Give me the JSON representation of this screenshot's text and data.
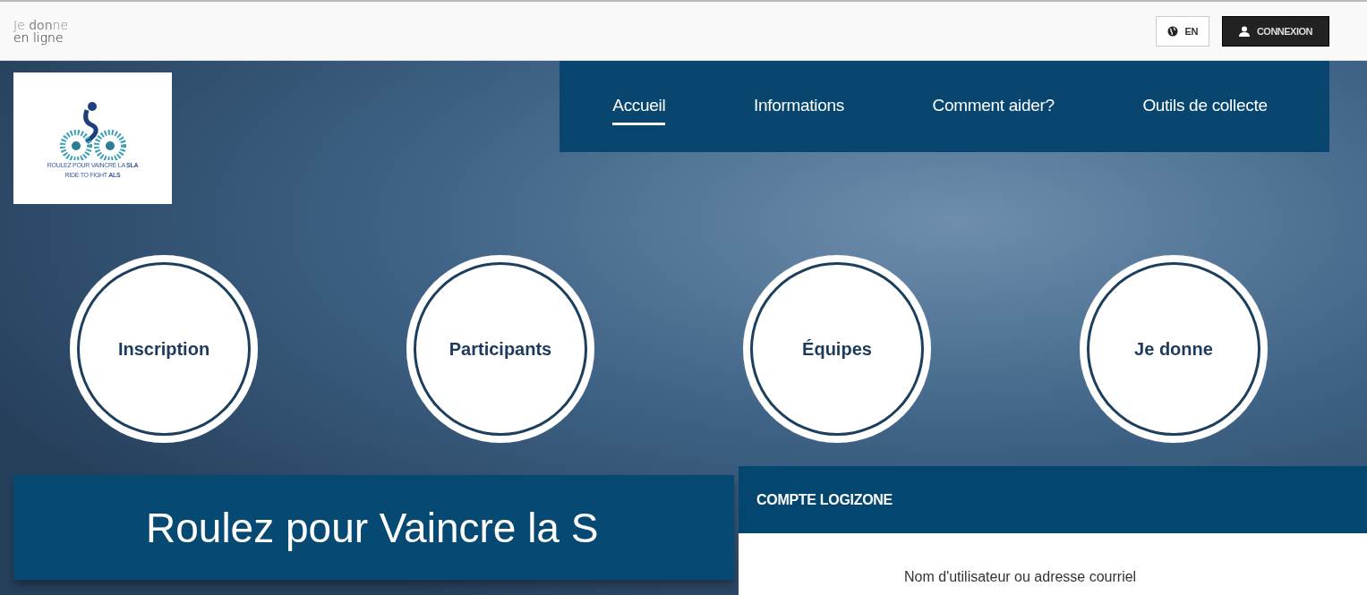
{
  "brand": {
    "lines": [
      "Je **don**ne",
      "en ligne"
    ]
  },
  "header_buttons": [
    {
      "kind": "language",
      "label": "EN"
    },
    {
      "kind": "login",
      "label": "CONNEXION"
    }
  ],
  "logo": {
    "lines": [
      "ROULEZ POUR VAINCRE LA **SLA**",
      "RIDE TO FIGHT **ALS**"
    ]
  },
  "nav": [
    {
      "label": "Accueil",
      "selected": true
    },
    {
      "label": "Informations",
      "selected": false
    },
    {
      "label": "Comment aider?",
      "selected": false
    },
    {
      "label": "Outils de collecte",
      "selected": false
    }
  ],
  "circles": [
    "Inscription",
    "Participants",
    "Équipes",
    "Je donne"
  ],
  "hero_title": "Roulez pour Vaincre la S",
  "dialog": {
    "title": "COMPTE LOGIZONE",
    "field_label": "Nom d'utilisateur ou adresse courriel"
  }
}
